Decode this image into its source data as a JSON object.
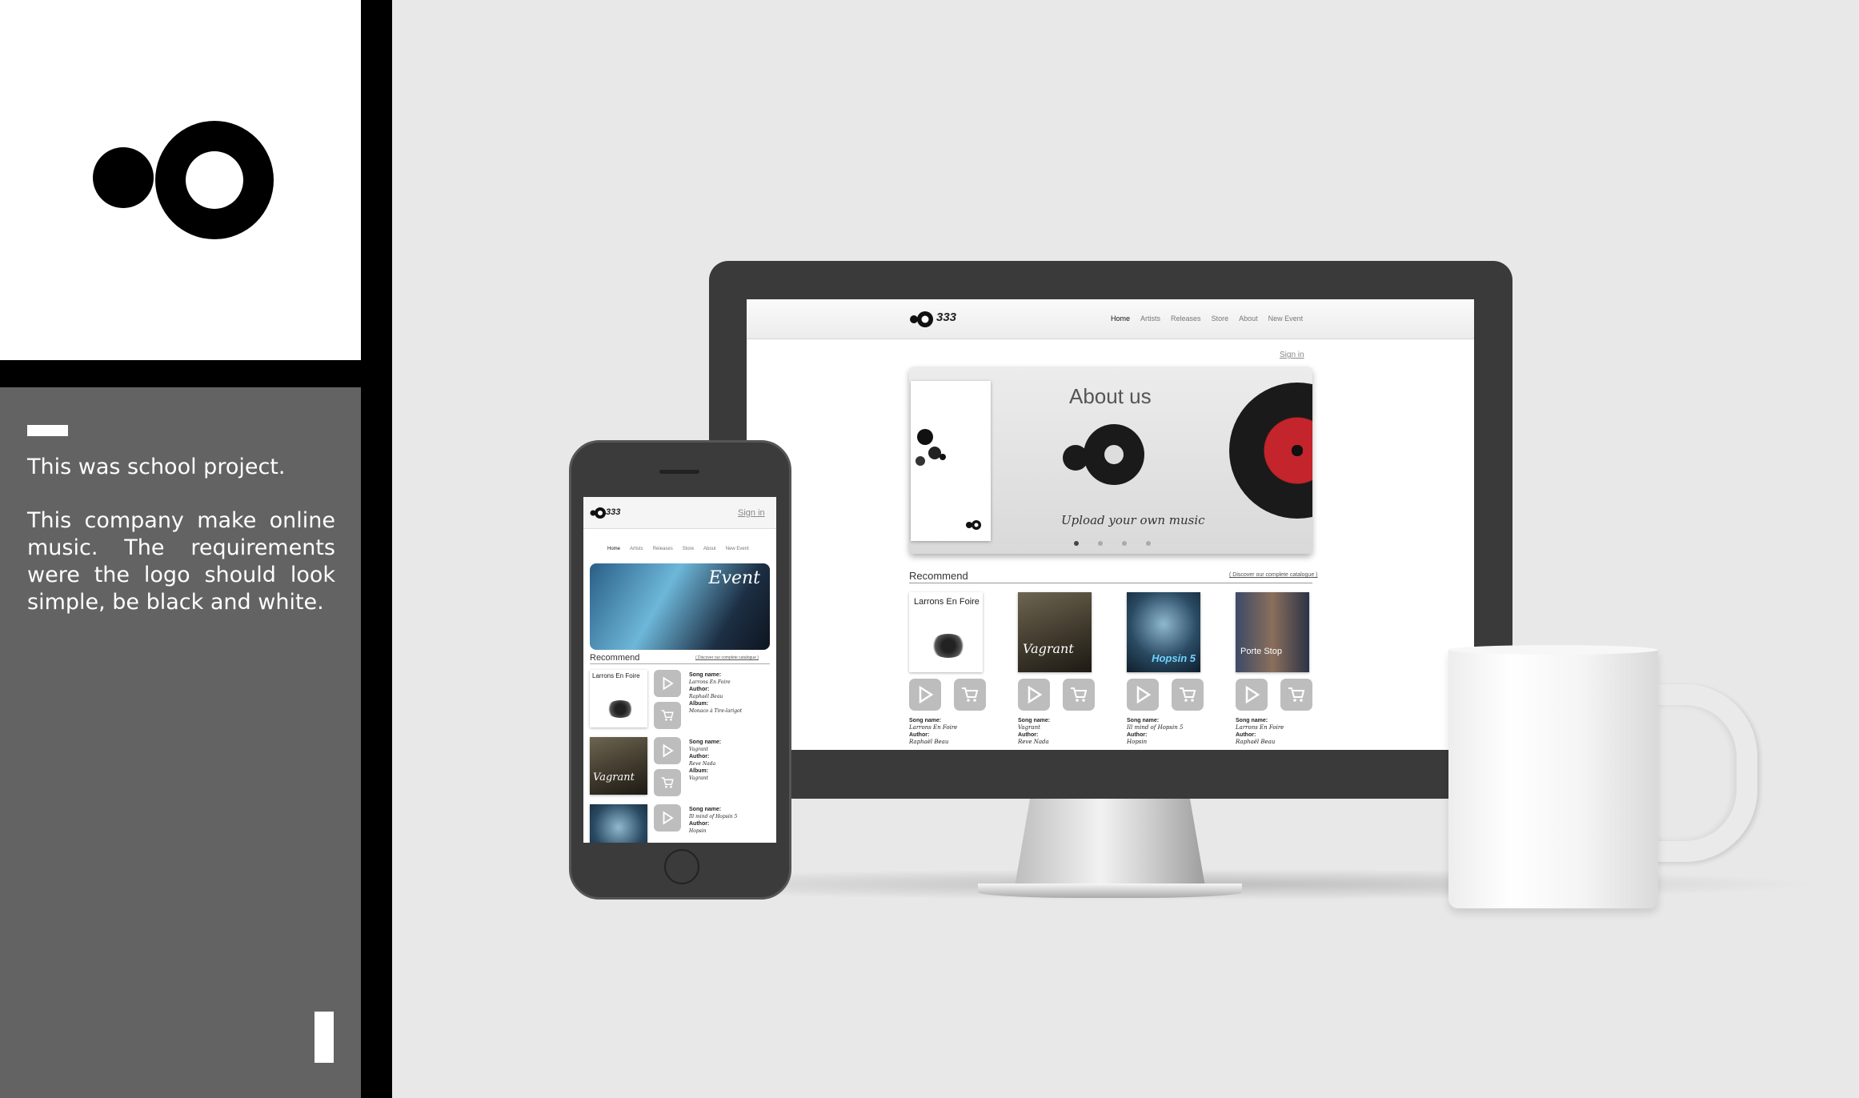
{
  "description": {
    "line1": "This was school project.",
    "line2": "This company make online music. The requirements were the logo should look simple, be black and white."
  },
  "brand": {
    "name": "333",
    "logo_icon": "circle-dot-logo-icon"
  },
  "desktop": {
    "nav": [
      "Home",
      "Artists",
      "Releases",
      "Store",
      "About",
      "New Event"
    ],
    "signin": "Sign in",
    "hero": {
      "title": "About us",
      "subtitle": "Upload your own music"
    },
    "recommend": {
      "title": "Recommend",
      "link": "( Discover our complete catalogue )"
    },
    "albums": [
      {
        "cover": "Larrons En Foire",
        "song": "Larrons En Foire",
        "author": "Raphaël Beau"
      },
      {
        "cover": "Vagrant",
        "song": "Vagrant",
        "author": "Reve Nada"
      },
      {
        "cover": "Hopsin 5",
        "song": "Ill mind of Hopsin 5",
        "author": "Hopsin"
      },
      {
        "cover": "Porte Stop",
        "song": "Larrons En Foire",
        "author": "Raphaël Beau"
      }
    ],
    "labels": {
      "song": "Song name:",
      "author": "Author:"
    }
  },
  "mobile": {
    "signin": "Sign in",
    "nav": [
      "Home",
      "Artists",
      "Releases",
      "Store",
      "About",
      "New Event"
    ],
    "event": "Event",
    "recommend": {
      "title": "Recommend",
      "link": "( Discover our complete catalogue )"
    },
    "albums": [
      {
        "cover": "Larrons En Foire",
        "song": "Larrons En Foire",
        "author": "Raphaël Beau",
        "album": "Monaco à Tire-larigot"
      },
      {
        "cover": "Vagrant",
        "song": "Vagrant",
        "author": "Reve Nada",
        "album": "Vagrant"
      },
      {
        "cover": "",
        "song": "Ill mind of Hopsin 5",
        "author": "Hopsin",
        "album": ""
      }
    ],
    "labels": {
      "song": "Song name:",
      "author": "Author:",
      "album": "Album:"
    }
  }
}
